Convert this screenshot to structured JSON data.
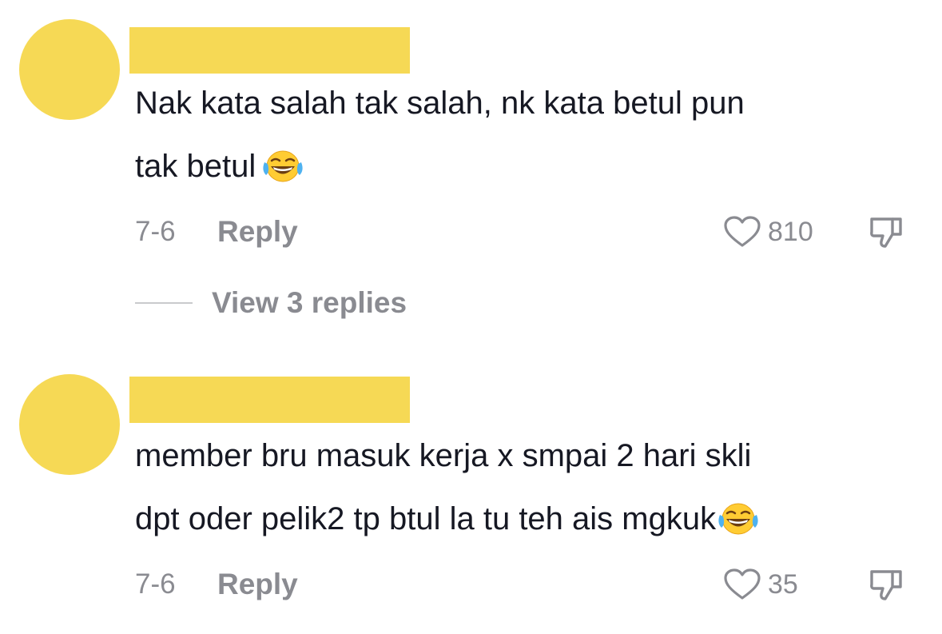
{
  "comments": [
    {
      "lines": [
        "Nak kata salah tak salah, nk kata betul pun",
        "tak betul"
      ],
      "emoji": "face-with-tears-of-joy",
      "date": "7-6",
      "reply_label": "Reply",
      "likes": "810"
    },
    {
      "lines": [
        "member bru masuk kerja x smpai 2 hari skli",
        "dpt oder pelik2 tp btul la tu teh ais mgkuk"
      ],
      "emoji": "face-with-tears-of-joy",
      "date": "7-6",
      "reply_label": "Reply",
      "likes": "35"
    }
  ],
  "view_replies_label": "View 3 replies",
  "colors": {
    "redaction": "#f6d955",
    "text": "#161823",
    "muted": "#8a8b91"
  }
}
